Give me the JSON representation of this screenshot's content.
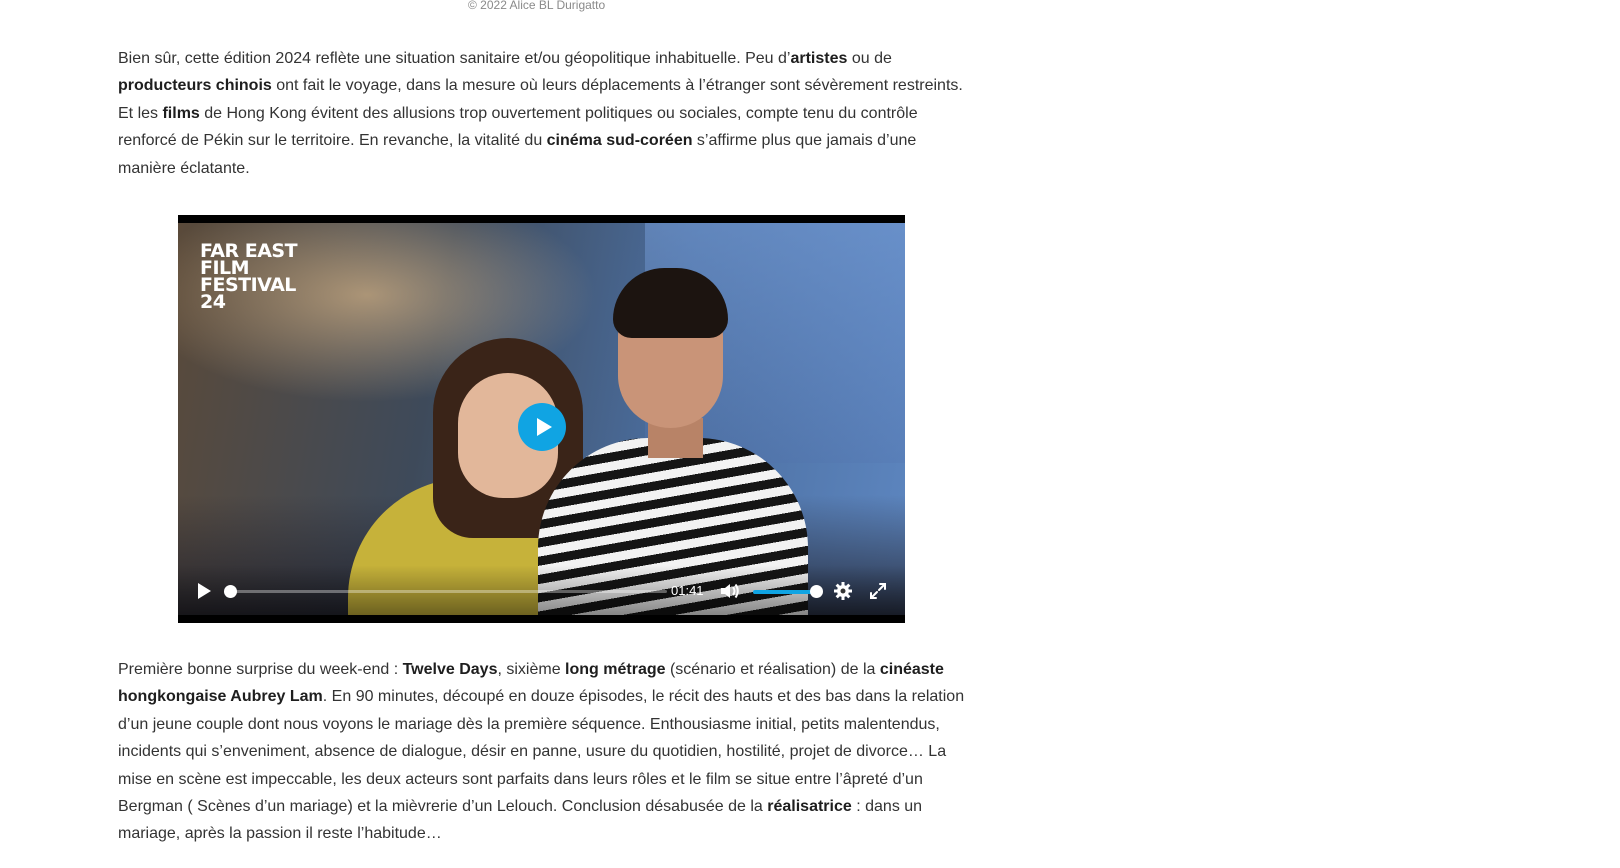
{
  "caption": "© 2022 Alice BL Durigatto",
  "paragraph1": [
    {
      "t": "Bien sûr, cette édition 2024 reflète une situation sanitaire et/ou géopolitique inhabituelle. Peu d’",
      "b": false
    },
    {
      "t": "artistes",
      "b": true
    },
    {
      "t": " ou de ",
      "b": false
    },
    {
      "t": "producteurs chinois",
      "b": true
    },
    {
      "t": " ont fait le voyage, dans la mesure où leurs déplacements à l’étranger sont sévèrement restreints. Et les ",
      "b": false
    },
    {
      "t": "films",
      "b": true
    },
    {
      "t": " de Hong Kong évitent des allusions trop ouvertement politiques ou sociales, compte  tenu du contrôle renforcé de Pékin sur le territoire. En revanche, la vitalité du ",
      "b": false
    },
    {
      "t": "cinéma sud-coréen",
      "b": true
    },
    {
      "t": " s’affirme plus que jamais d’une manière éclatante.",
      "b": false
    }
  ],
  "video": {
    "logo_lines": [
      "FAR EAST",
      "FILM",
      "FESTIVAL",
      "24"
    ],
    "time": "01:41",
    "progress": 0.0,
    "volume": 1.0,
    "accent_color": "#10a4e3",
    "icons": {
      "big_play": "play-icon",
      "play": "play-icon",
      "mute": "volume-icon",
      "settings": "gear-icon",
      "fullscreen": "fullscreen-icon"
    }
  },
  "paragraph2": [
    {
      "t": "Première bonne surprise du week-end : ",
      "b": false
    },
    {
      "t": "Twelve Days",
      "b": true
    },
    {
      "t": ", sixième ",
      "b": false
    },
    {
      "t": "long métrage",
      "b": true
    },
    {
      "t": " (scénario et réalisation) de la ",
      "b": false
    },
    {
      "t": "cinéaste hongkongaise Aubrey Lam",
      "b": true
    },
    {
      "t": ". En 90 minutes, découpé en douze épisodes, le récit des hauts et des bas dans la relation d’un jeune couple dont nous voyons le mariage dès la première séquence. Enthousiasme initial, petits malentendus, incidents qui s’enveniment, absence de dialogue, désir en panne, usure du quotidien, hostilité, projet de divorce… La mise en scène est impeccable, les deux acteurs sont parfaits dans leurs rôles et le film se situe entre l’âpreté d’un Bergman ( Scènes d’un mariage) et la mièvrerie d’un Lelouch. Conclusion désabusée de la ",
      "b": false
    },
    {
      "t": "réalisatrice",
      "b": true
    },
    {
      "t": " : dans un mariage, après la passion il reste l’habitude…",
      "b": false
    }
  ]
}
